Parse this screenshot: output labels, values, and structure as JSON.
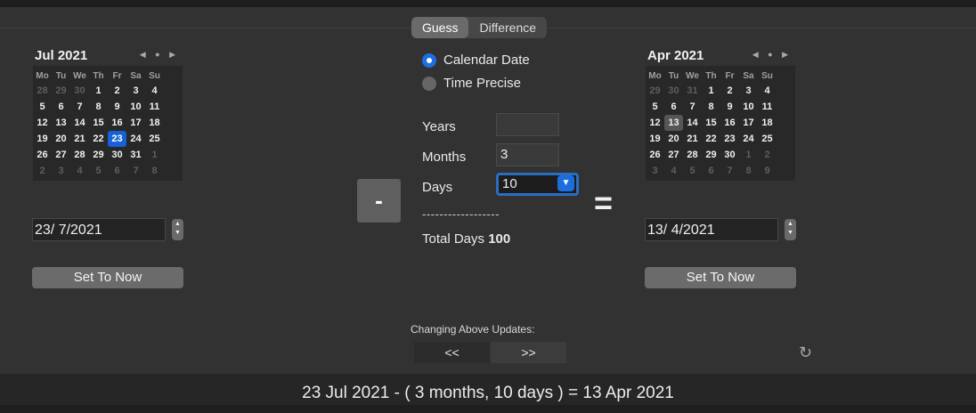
{
  "tabs": {
    "guess": "Guess",
    "difference": "Difference"
  },
  "left_calendar": {
    "title": "Jul 2021",
    "arrows": "◀ ● ▶",
    "weekdays": [
      "Mo",
      "Tu",
      "We",
      "Th",
      "Fr",
      "Sa",
      "Su"
    ],
    "weeks": [
      [
        "28",
        "29",
        "30",
        "1",
        "2",
        "3",
        "4"
      ],
      [
        "5",
        "6",
        "7",
        "8",
        "9",
        "10",
        "11"
      ],
      [
        "12",
        "13",
        "14",
        "15",
        "16",
        "17",
        "18"
      ],
      [
        "19",
        "20",
        "21",
        "22",
        "23",
        "24",
        "25"
      ],
      [
        "26",
        "27",
        "28",
        "29",
        "30",
        "31",
        "1"
      ],
      [
        "2",
        "3",
        "4",
        "5",
        "6",
        "7",
        "8"
      ]
    ],
    "selected": "23",
    "date_field": "23/ 7/2021",
    "set_now": "Set To Now"
  },
  "right_calendar": {
    "title": "Apr 2021",
    "arrows": "◀ ● ▶",
    "weekdays": [
      "Mo",
      "Tu",
      "We",
      "Th",
      "Fr",
      "Sa",
      "Su"
    ],
    "weeks": [
      [
        "29",
        "30",
        "31",
        "1",
        "2",
        "3",
        "4"
      ],
      [
        "5",
        "6",
        "7",
        "8",
        "9",
        "10",
        "11"
      ],
      [
        "12",
        "13",
        "14",
        "15",
        "16",
        "17",
        "18"
      ],
      [
        "19",
        "20",
        "21",
        "22",
        "23",
        "24",
        "25"
      ],
      [
        "26",
        "27",
        "28",
        "29",
        "30",
        "1",
        "2"
      ],
      [
        "3",
        "4",
        "5",
        "6",
        "7",
        "8",
        "9"
      ]
    ],
    "selected": "13",
    "date_field": "13/ 4/2021",
    "set_now": "Set To Now"
  },
  "mode": {
    "calendar_date": "Calendar Date",
    "time_precise": "Time Precise"
  },
  "fields": {
    "years_label": "Years",
    "years_value": "",
    "months_label": "Months",
    "months_value": "3",
    "days_label": "Days",
    "days_value": "10"
  },
  "operator": "-",
  "equals": "=",
  "dashes": "------------------",
  "total": {
    "label": "Total Days",
    "value": "100"
  },
  "updates": {
    "label": "Changing Above Updates:",
    "left": "<<",
    "right": ">>"
  },
  "footer": "23 Jul 2021 - ( 3 months, 10 days ) = 13 Apr 2021",
  "colors": {
    "accent": "#1761d6",
    "window": "#323232",
    "footer": "#262626"
  }
}
